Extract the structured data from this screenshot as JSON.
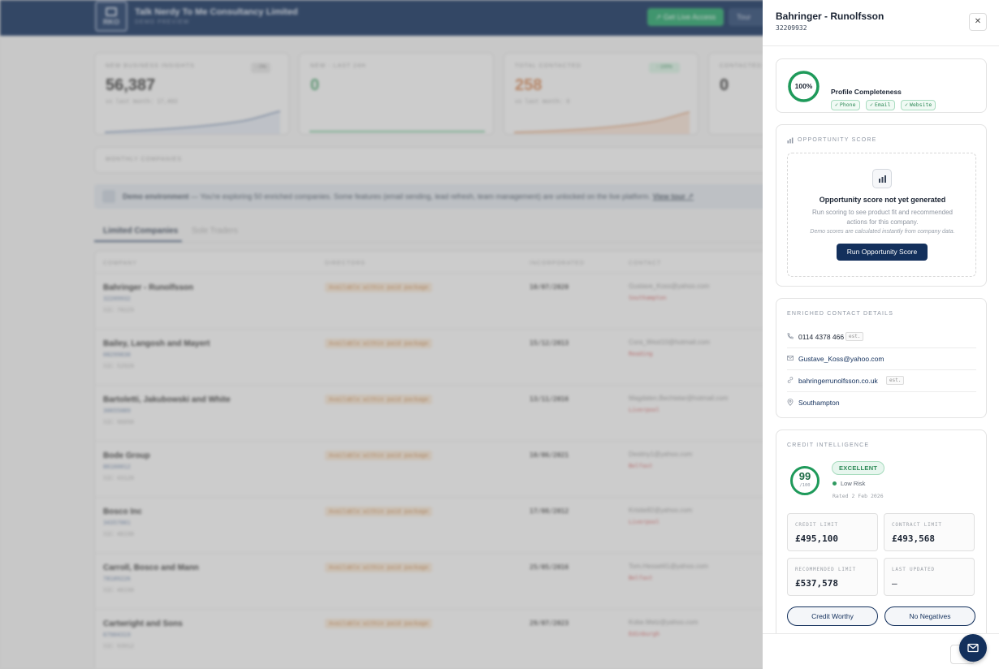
{
  "app": {
    "logo_text": "RKO",
    "company_name": "Talk Nerdy To Me Consultancy Limited",
    "subtitle": "DEMO PREVIEW",
    "live_button": "↗ Get Live Access",
    "tour_button": "Tour"
  },
  "stats": [
    {
      "label": "NEW BUSINESS INSIGHTS",
      "value": "56,387",
      "sub": "vs last month: 17,403",
      "badge": "− 0%"
    },
    {
      "label": "NEW · LAST 24H",
      "value": "0",
      "sub": "",
      "badge": ""
    },
    {
      "label": "TOTAL CONTACTED",
      "value": "258",
      "sub": "vs last month: 0",
      "badge": "↑ 100%"
    },
    {
      "label": "CONTACTED T",
      "value": "0",
      "sub": "",
      "badge": ""
    }
  ],
  "monthly_label": "MONTHLY COMPANIES",
  "demo_banner": {
    "bold": "Demo environment",
    "text": " — You're exploring 50 enriched companies. Some features (email sending, lead refresh, team management) are unlocked on the live platform. ",
    "link": "View tour ↗"
  },
  "tabs": [
    "Limited Companies",
    "Sole Traders"
  ],
  "table": {
    "headers": [
      "COMPANY",
      "DIRECTORS",
      "INCORPORATED",
      "CONTACT"
    ],
    "rows": [
      {
        "name": "Bahringer - Runolfsson",
        "number": "32209932",
        "sic": "SIC 70229",
        "directors": "Available within paid package",
        "date": "10/07/2020",
        "email": "Gustave_Koss@yahoo.com",
        "city": "Southampton"
      },
      {
        "name": "Bailey, Langosh and Mayert",
        "number": "08299838",
        "sic": "SIC 52920",
        "directors": "Available within paid package",
        "date": "15/12/2013",
        "email": "Cora_West10@hotmail.com",
        "city": "Reading"
      },
      {
        "name": "Bartoletti, Jakubowski and White",
        "number": "30655089",
        "sic": "SIC 96090",
        "directors": "Available within paid package",
        "date": "13/11/2016",
        "email": "Magdalen.Bechtelar@hotmail.com",
        "city": "Liverpool"
      },
      {
        "name": "Bode Group",
        "number": "86160012",
        "sic": "SIC 43120",
        "directors": "Available within paid package",
        "date": "10/06/2021",
        "email": "Destiny1@yahoo.com",
        "city": "Belfast"
      },
      {
        "name": "Bosco Inc",
        "number": "34357001",
        "sic": "SIC 46190",
        "directors": "Available within paid package",
        "date": "17/08/2012",
        "email": "Kristie82@yahoo.com",
        "city": "Liverpool"
      },
      {
        "name": "Carroll, Bosco and Mann",
        "number": "78189226",
        "sic": "SIC 46190",
        "directors": "Available within paid package",
        "date": "25/05/2016",
        "email": "Tom.Hessel41@yahoo.com",
        "city": "Belfast"
      },
      {
        "name": "Cartwright and Sons",
        "number": "67904319",
        "sic": "SIC 93912",
        "directors": "Available within paid package",
        "date": "29/07/2023",
        "email": "Kobe.Metz@yahoo.com",
        "city": "Edinburgh"
      }
    ]
  },
  "panel": {
    "title": "Bahringer - Runolfsson",
    "company_number": "32209932",
    "close_icon": "close-icon",
    "profile": {
      "completeness": 100,
      "completeness_text": "100%",
      "label": "Profile Completeness",
      "chips": [
        "Phone",
        "Email",
        "Website"
      ]
    },
    "opportunity": {
      "title": "OPPORTUNITY SCORE",
      "heading": "Opportunity score not yet generated",
      "body": "Run scoring to see product fit and recommended actions for this company.",
      "note": "Demo scores are calculated instantly from company data.",
      "button": "Run Opportunity Score"
    },
    "contact": {
      "title": "ENRICHED CONTACT DETAILS",
      "phone": "0114 4378 466",
      "phone_tag": "est.",
      "email": "Gustave_Koss@yahoo.com",
      "website": "bahringerrunolfsson.co.uk",
      "website_tag": "est.",
      "location": "Southampton"
    },
    "credit": {
      "title": "CREDIT INTELLIGENCE",
      "score": 99,
      "score_text": "99",
      "score_max": "/100",
      "rating": "EXCELLENT",
      "risk": "Low Risk",
      "rated": "Rated 2 Feb 2026",
      "credit_limit_label": "CREDIT LIMIT",
      "credit_limit": "£495,100",
      "contract_limit_label": "CONTRACT LIMIT",
      "contract_limit": "£493,568",
      "recommended_limit_label": "RECOMMENDED LIMIT",
      "recommended_limit": "£537,578",
      "last_updated_label": "LAST UPDATED",
      "last_updated": "–",
      "button_worthy": "Credit Worthy",
      "button_negatives": "No Negatives"
    }
  },
  "colors": {
    "navy": "#13305c",
    "green": "#26a269",
    "ring_green": "#1e9a5a"
  }
}
